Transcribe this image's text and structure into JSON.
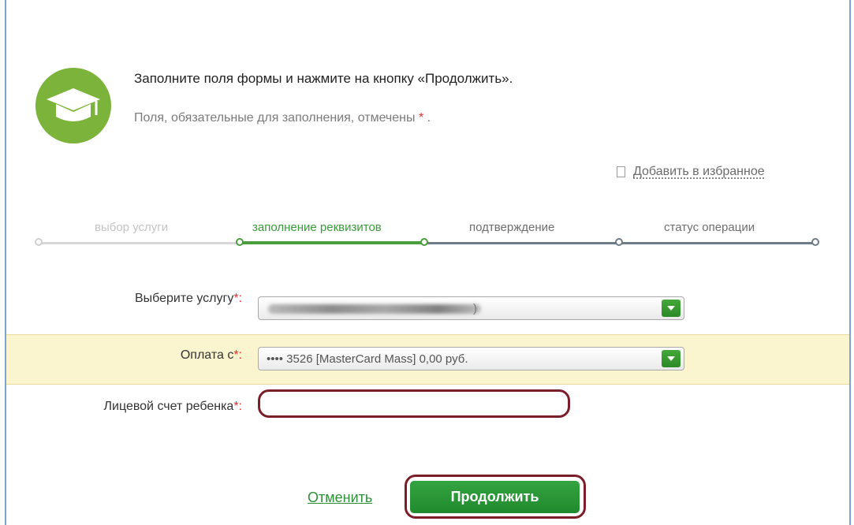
{
  "header": {
    "title": "Заполните поля формы и нажмите на кнопку «Продолжить».",
    "subtitle_prefix": "Поля, обязательные для заполнения, отмечены",
    "subtitle_star": "*",
    "subtitle_suffix": "."
  },
  "favorite": {
    "label": "Добавить в избранное",
    "icon": "bookmark-icon"
  },
  "steps": [
    {
      "label": "выбор услуги",
      "state": "done"
    },
    {
      "label": "заполнение реквизитов",
      "state": "current"
    },
    {
      "label": "подтверждение",
      "state": "upcoming"
    },
    {
      "label": "статус операции",
      "state": "upcoming"
    }
  ],
  "form": {
    "service": {
      "label": "Выберите услугу",
      "required": "*:",
      "value_tail": ")",
      "value_blurred": true
    },
    "payment": {
      "label": "Оплата с",
      "required": "*:",
      "value": "•••• 3526 [MasterCard Mass] 0,00 руб."
    },
    "account": {
      "label": "Лицевой счет ребенка",
      "required": "*:",
      "value": ""
    }
  },
  "actions": {
    "cancel": "Отменить",
    "continue": "Продолжить"
  },
  "colors": {
    "brand_green": "#7bb33b",
    "button_green": "#2a9637",
    "required_red": "#e0302e",
    "highlight_ring": "#7a1f2a",
    "payment_band": "#faf4cf"
  }
}
